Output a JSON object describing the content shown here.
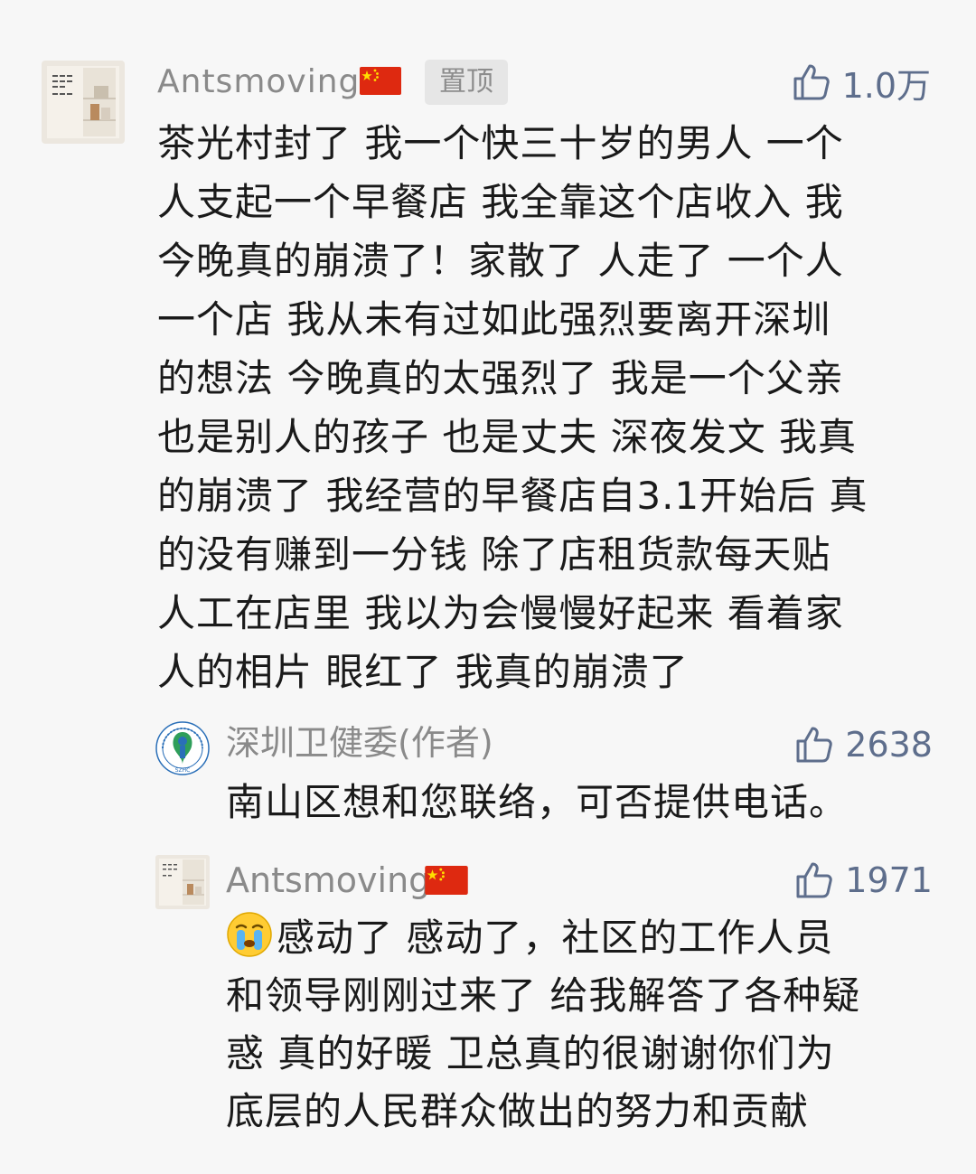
{
  "colors": {
    "background": "#f7f7f7",
    "username": "#8a8a8a",
    "like": "#5e6e8c",
    "text": "#1a1a1a",
    "pin_badge_bg": "#e6e6e6"
  },
  "main_comment": {
    "username": "Antsmoving",
    "flag_icon": "china-flag-icon",
    "pin_label": "置顶",
    "like_count": "1.0万",
    "avatar_icon": "shelf-avatar-icon",
    "text": "茶光村封了 我一个快三十岁的男人 一个\n人支起一个早餐店 我全靠这个店收入 我\n今晚真的崩溃了！家散了 人走了 一个人\n一个店 我从未有过如此强烈要离开深圳\n的想法 今晚真的太强烈了 我是一个父亲\n也是别人的孩子 也是丈夫  深夜发文 我真\n的崩溃了 我经营的早餐店自3.1开始后 真\n的没有赚到一分钱 除了店租货款每天贴\n人工在店里  我以为会慢慢好起来 看着家\n人的相片 眼红了 我真的崩溃了"
  },
  "replies": [
    {
      "username": "深圳卫健委(作者)",
      "avatar_icon": "szhc-logo-icon",
      "like_count": "2638",
      "text": "南山区想和您联络，可否提供电话。"
    },
    {
      "username": "Antsmoving",
      "avatar_icon": "shelf-avatar-icon",
      "flag_icon": "china-flag-icon",
      "like_count": "1971",
      "emoji_icon": "crying-face-emoji-icon",
      "text": "感动了 感动了，社区的工作人员\n和领导刚刚过来了 给我解答了各种疑\n惑 真的好暖 卫总真的很谢谢你们为\n底层的人民群众做出的努力和贡献"
    }
  ]
}
